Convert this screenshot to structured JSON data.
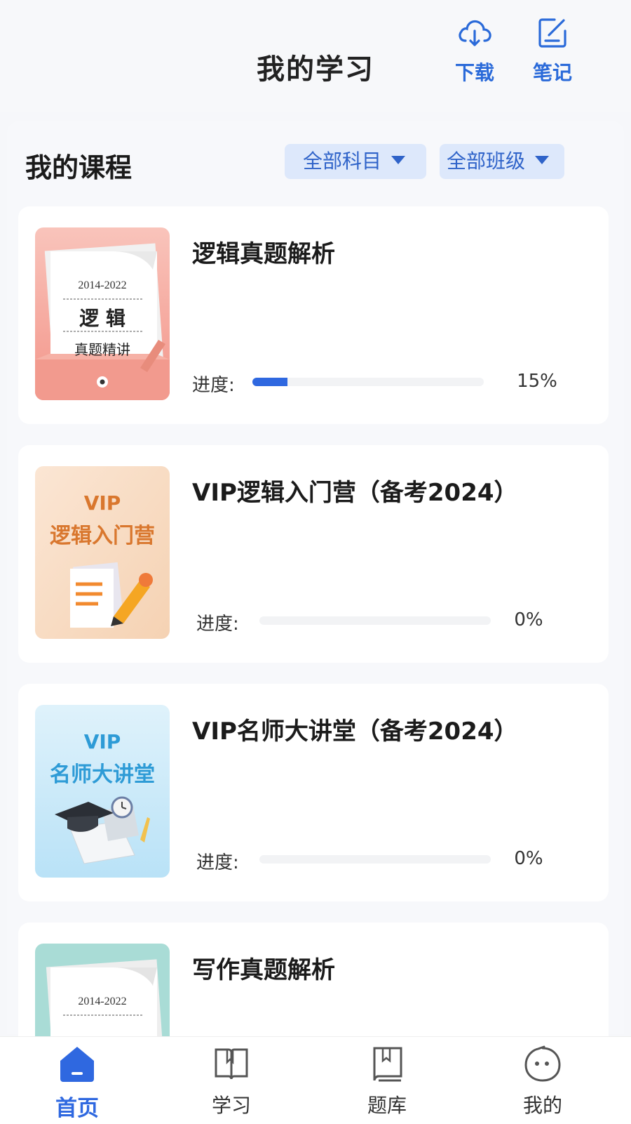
{
  "header": {
    "title": "我的学习",
    "actions": [
      {
        "label": "下载",
        "icon": "cloud-download-icon"
      },
      {
        "label": "笔记",
        "icon": "note-edit-icon"
      }
    ]
  },
  "section": {
    "title": "我的课程",
    "filters": [
      {
        "label": "全部科目"
      },
      {
        "label": "全部班级"
      }
    ]
  },
  "courses": [
    {
      "title": "逻辑真题解析",
      "progress_label": "进度:",
      "progress": 15,
      "progress_text": "15%",
      "thumb": {
        "years": "2014-2022",
        "subject": "逻 辑",
        "caption": "真题精讲"
      }
    },
    {
      "title": "VIP逻辑入门营（备考2024）",
      "progress_label": "进度:",
      "progress": 0,
      "progress_text": "0%",
      "thumb": {
        "line1": "VIP",
        "line2": "逻辑入门营"
      }
    },
    {
      "title": "VIP名师大讲堂（备考2024）",
      "progress_label": "进度:",
      "progress": 0,
      "progress_text": "0%",
      "thumb": {
        "line1": "VIP",
        "line2": "名师大讲堂"
      }
    },
    {
      "title": "写作真题解析",
      "thumb": {
        "years": "2014-2022"
      }
    }
  ],
  "tabbar": {
    "tabs": [
      {
        "label": "首页",
        "icon": "home-icon",
        "active": true
      },
      {
        "label": "学习",
        "icon": "book-icon",
        "active": false
      },
      {
        "label": "题库",
        "icon": "question-bank-icon",
        "active": false
      },
      {
        "label": "我的",
        "icon": "profile-face-icon",
        "active": false
      }
    ]
  },
  "colors": {
    "accent": "#2f68e0",
    "filter_bg": "#dde8fb",
    "filter_text": "#2f63c9"
  }
}
